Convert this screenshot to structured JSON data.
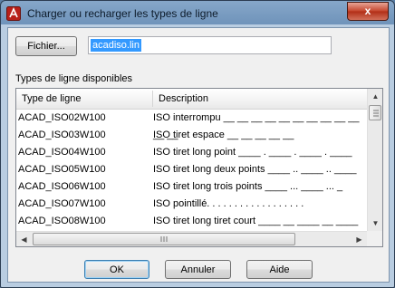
{
  "window": {
    "title": "Charger ou recharger les types de ligne",
    "close_label": "x"
  },
  "file": {
    "button_label": "Fichier...",
    "value": "acadiso.lin"
  },
  "list": {
    "section_label": "Types de ligne disponibles",
    "columns": [
      "Type de ligne",
      "Description"
    ],
    "rows": [
      {
        "name": "ACAD_ISO02W100",
        "description": "ISO interrompu __ __ __ __ __ __ __ __ __ __ __ __",
        "pattern": "dash"
      },
      {
        "name": "ACAD_ISO03W100",
        "description": "ISO tiret espace __    __    __    __    __",
        "pattern": "dash-space"
      },
      {
        "name": "ACAD_ISO04W100",
        "description": "ISO tiret long point ____ . ____ . ____ . ____",
        "pattern": "long-dot"
      },
      {
        "name": "ACAD_ISO05W100",
        "description": "ISO tiret long deux points ____ .. ____ .. ____",
        "pattern": "long-2dot"
      },
      {
        "name": "ACAD_ISO06W100",
        "description": "ISO tiret long trois points ____ ... ____ ... _",
        "pattern": "long-3dot"
      },
      {
        "name": "ACAD_ISO07W100",
        "description": "ISO pointillé. . . . . . . . . . . . . . . . . .",
        "pattern": "dots"
      },
      {
        "name": "ACAD_ISO08W100",
        "description": "ISO tiret long tiret court ____ __ ____ __ ____",
        "pattern": "long-short"
      }
    ]
  },
  "buttons": {
    "ok": "OK",
    "cancel": "Annuler",
    "help": "Aide"
  },
  "colors": {
    "selection": "#3399ff",
    "close_button": "#c4442b",
    "title_bar": "#6f93ba"
  }
}
